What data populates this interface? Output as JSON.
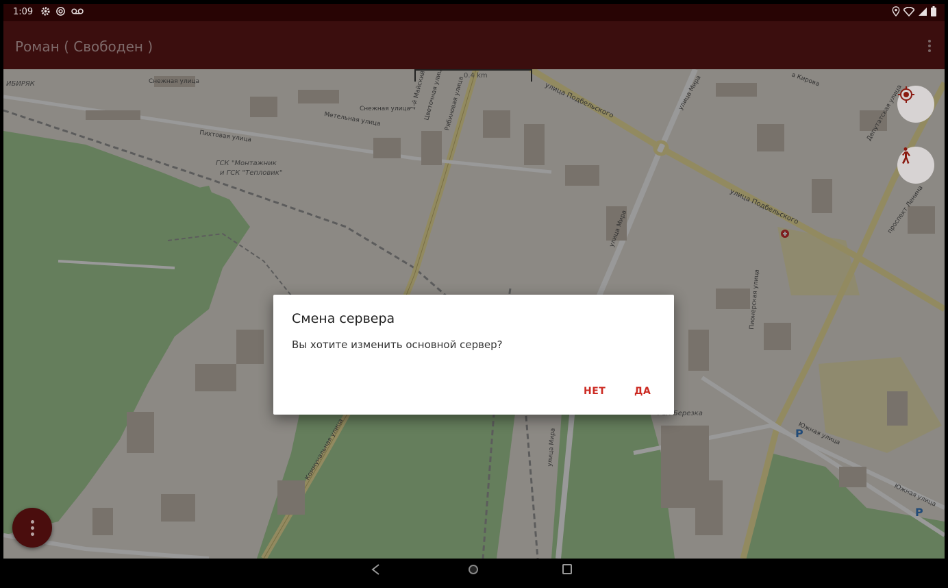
{
  "status_bar": {
    "time": "1:09",
    "icons_left": [
      "settings-icon",
      "cast-icon",
      "voicemail-icon"
    ],
    "icons_right": [
      "location-icon",
      "wifi-icon",
      "signal-icon",
      "battery-icon"
    ]
  },
  "app_bar": {
    "title": "Роман ( Свободен )",
    "menu_icon": "overflow-menu-icon"
  },
  "map": {
    "scale_label": "0.4 km",
    "streets": [
      {
        "name": "Снежная улица"
      },
      {
        "name": "Снежная улица"
      },
      {
        "name": "Пихтовая улица"
      },
      {
        "name": "улица Подбельского"
      },
      {
        "name": "улица Подбельского"
      },
      {
        "name": "улица Мира"
      },
      {
        "name": "улица Мира"
      },
      {
        "name": "улица Мира"
      },
      {
        "name": "Коммунальная улица"
      },
      {
        "name": "Южная улица"
      },
      {
        "name": "Южная улица"
      },
      {
        "name": "проспект Ленина"
      },
      {
        "name": "Депутатская улица"
      },
      {
        "name": "Пионерская улица"
      },
      {
        "name": "Цветочная улица"
      },
      {
        "name": "Рябиновая улица"
      },
      {
        "name": "1-й Майский"
      },
      {
        "name": "Метельная улица"
      },
      {
        "name": "а Кирова"
      }
    ],
    "places": [
      {
        "name": "ГСК \"Монтажник"
      },
      {
        "name": "и ГСК \"Тепловик\""
      },
      {
        "name": "ГСК Березка"
      },
      {
        "name": "ИБИРЯК"
      },
      {
        "name": "P"
      },
      {
        "name": "P"
      }
    ],
    "controls": {
      "locate_icon": "my-location-icon",
      "walk_icon": "walk-icon"
    }
  },
  "dialog": {
    "title": "Смена сервера",
    "message": "Вы хотите изменить основной сервер?",
    "negative": "НЕТ",
    "positive": "ДА"
  },
  "colors": {
    "status_bar": "#280404",
    "app_bar": "#3b0e0e",
    "accent": "#cc2a22",
    "map_bg": "#e9e4dc",
    "forest": "#a8d29a"
  }
}
